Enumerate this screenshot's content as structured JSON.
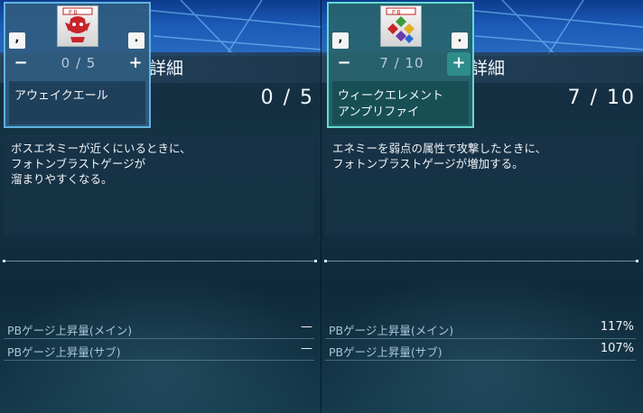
{
  "left": {
    "title_fragment": "詳細",
    "stepper_value": "0 / 5",
    "key_left": ",",
    "key_right": ".",
    "minus": "−",
    "plus": "+",
    "skill_name": [
      "アウェイクエール"
    ],
    "level_display": "0 / 5",
    "description": [
      "ボスエネミーが近くにいるときに、",
      "フォトンブラストゲージが",
      "溜まりやすくなる。"
    ],
    "stats": [
      {
        "label": "PBゲージ上昇量(メイン)",
        "value": "—"
      },
      {
        "label": "PBゲージ上昇量(サブ)",
        "value": "—"
      }
    ]
  },
  "right": {
    "title_fragment": "詳細",
    "stepper_value": "7 / 10",
    "key_left": ",",
    "key_right": ".",
    "minus": "−",
    "plus": "+",
    "skill_name": [
      "ウィークエレメント",
      "アンプリファイ"
    ],
    "level_display": "7 / 10",
    "description": [
      "エネミーを弱点の属性で攻撃したときに、",
      "フォトンブラストゲージが増加する。"
    ],
    "stats": [
      {
        "label": "PBゲージ上昇量(メイン)",
        "value": "117%"
      },
      {
        "label": "PBゲージ上昇量(サブ)",
        "value": "107%"
      }
    ]
  },
  "icons": {
    "left_skill_icon": "red-boss-emblem-icon",
    "right_skill_icon": "four-element-gems-icon"
  }
}
